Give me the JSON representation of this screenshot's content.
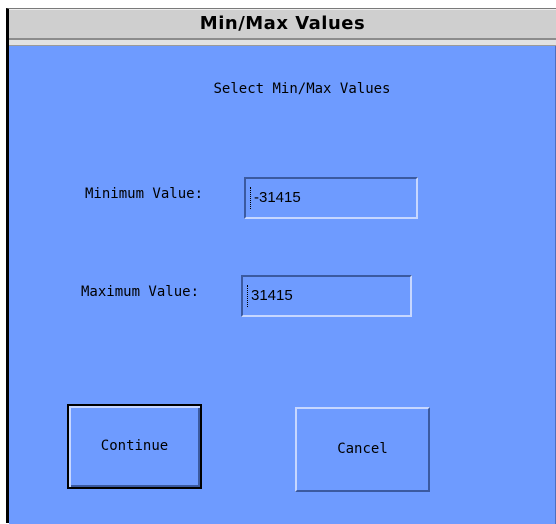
{
  "window": {
    "title": "Min/Max Values"
  },
  "dialog": {
    "heading": "Select Min/Max Values",
    "min_label": "Minimum Value:",
    "min_value": "-31415",
    "max_label": "Maximum Value:",
    "max_value": "31415",
    "continue_label": "Continue",
    "cancel_label": "Cancel"
  },
  "colors": {
    "background": "#6e9bff",
    "titlebar": "#cfcfcf"
  }
}
